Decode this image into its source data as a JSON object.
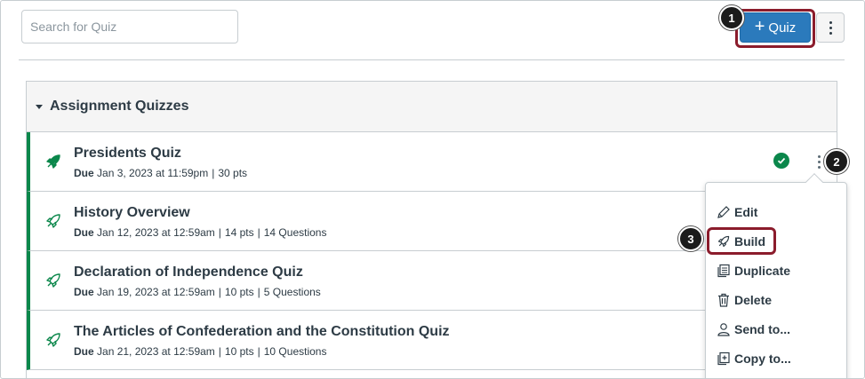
{
  "search": {
    "placeholder": "Search for Quiz"
  },
  "toolbar": {
    "add_quiz_label": "Quiz",
    "plus_glyph": "+"
  },
  "group": {
    "title": "Assignment Quizzes"
  },
  "quizzes": [
    {
      "title": "Presidents Quiz",
      "due_label": "Due",
      "due": "Jan 3, 2023 at 11:59pm",
      "points": "30 pts",
      "questions": "",
      "published": true
    },
    {
      "title": "History Overview",
      "due_label": "Due",
      "due": "Jan 12, 2023 at 12:59am",
      "points": "14 pts",
      "questions": "14 Questions",
      "published": false
    },
    {
      "title": "Declaration of Independence Quiz",
      "due_label": "Due",
      "due": "Jan 19, 2023 at 12:59am",
      "points": "10 pts",
      "questions": "5 Questions",
      "published": false
    },
    {
      "title": "The Articles of Confederation and the Constitution Quiz",
      "due_label": "Due",
      "due": "Jan 21, 2023 at 12:59am",
      "points": "10 pts",
      "questions": "10 Questions",
      "published": false
    }
  ],
  "meta_separator": "|",
  "menu": {
    "items": [
      {
        "label": "Edit",
        "icon": "pencil-icon"
      },
      {
        "label": "Build",
        "icon": "rocket-icon"
      },
      {
        "label": "Duplicate",
        "icon": "duplicate-icon"
      },
      {
        "label": "Delete",
        "icon": "trash-icon"
      },
      {
        "label": "Send to...",
        "icon": "user-icon"
      },
      {
        "label": "Copy to...",
        "icon": "copy-icon"
      }
    ]
  },
  "callouts": [
    "1",
    "2",
    "3"
  ],
  "colors": {
    "accent": "#2b7abc",
    "published": "#0b874b",
    "highlight": "#8b1c2c"
  }
}
